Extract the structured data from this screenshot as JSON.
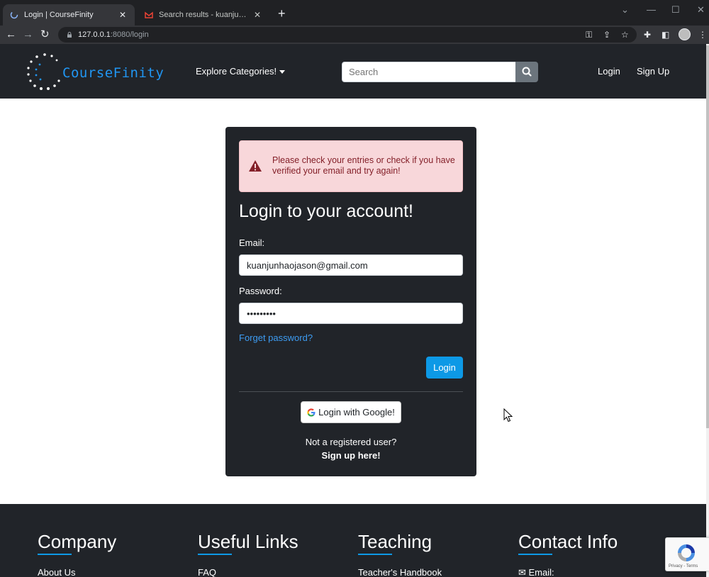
{
  "browser": {
    "tabs": [
      {
        "title": "Login | CourseFinity",
        "active": true
      },
      {
        "title": "Search results - kuanjunhaojason",
        "active": false
      }
    ],
    "url_host": "127.0.0.1",
    "url_path": ":8080/login"
  },
  "site": {
    "logo_text": "CourseFinity",
    "explore_label": "Explore Categories!",
    "search_placeholder": "Search",
    "nav_login": "Login",
    "nav_signup": "Sign Up"
  },
  "alert": {
    "message": "Please check your entries or check if you have verified your email and try again!"
  },
  "login_form": {
    "heading": "Login to your account!",
    "email_label": "Email:",
    "email_value": "kuanjunhaojason@gmail.com",
    "password_label": "Password:",
    "password_value": "•••••••••",
    "forgot_link": "Forget password?",
    "login_button": "Login",
    "google_button": "Login with Google!",
    "not_registered": "Not a registered user?",
    "signup_link": "Sign up here!"
  },
  "footer": {
    "columns": [
      {
        "heading": "Company",
        "first_link": "About Us"
      },
      {
        "heading": "Useful Links",
        "first_link": "FAQ"
      },
      {
        "heading": "Teaching",
        "first_link": "Teacher's Handbook"
      },
      {
        "heading": "Contact Info",
        "first_link": "Email:"
      }
    ]
  },
  "recaptcha": {
    "legal": "Privacy - Terms"
  },
  "colors": {
    "accent": "#0d99e6",
    "logo": "#2196f3",
    "navbar": "#212429",
    "alert_bg": "#f8d7da",
    "alert_text": "#842029"
  }
}
